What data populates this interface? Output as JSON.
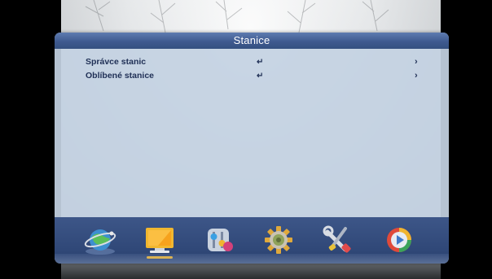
{
  "window": {
    "title": "Stanice"
  },
  "menu": {
    "items": [
      {
        "label": "Správce stanic",
        "enter_glyph": "↵",
        "chevron": "›"
      },
      {
        "label": "Oblíbené stanice",
        "enter_glyph": "↵",
        "chevron": "›"
      }
    ]
  },
  "icon_bar": {
    "icons": [
      {
        "name": "globe-satellite-icon"
      },
      {
        "name": "tv-monitor-icon",
        "selected": true
      },
      {
        "name": "settings-toggles-icon"
      },
      {
        "name": "gear-icon"
      },
      {
        "name": "tools-icon"
      },
      {
        "name": "media-play-icon"
      }
    ]
  },
  "colors": {
    "title_bar": "#3f5a90",
    "panel": "#c4d2e2",
    "text": "#1f2f55",
    "icon_bar": "#304878",
    "selection": "#f6c24a"
  }
}
